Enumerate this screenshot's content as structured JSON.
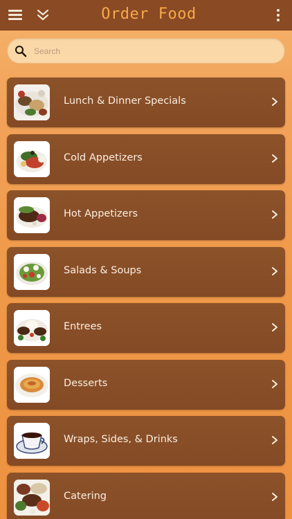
{
  "header": {
    "title": "Order Food",
    "menu_icon": "hamburger-menu-icon",
    "collapse_icon": "double-chevron-down-icon",
    "more_icon": "vertical-dots-icon"
  },
  "search": {
    "placeholder": "Search",
    "value": "",
    "icon": "search-icon"
  },
  "categories": [
    {
      "label": "Lunch & Dinner Specials",
      "thumb": "platter"
    },
    {
      "label": "Cold Appetizers",
      "thumb": "plate-salad"
    },
    {
      "label": "Hot Appetizers",
      "thumb": "meat-plate"
    },
    {
      "label": "Salads & Soups",
      "thumb": "salad"
    },
    {
      "label": "Entrees",
      "thumb": "kebab-rice"
    },
    {
      "label": "Desserts",
      "thumb": "dessert"
    },
    {
      "label": "Wraps, Sides, & Drinks",
      "thumb": "tea-cup"
    },
    {
      "label": "Catering",
      "thumb": "catering-spread"
    }
  ],
  "colors": {
    "header_bg": "#8a4a23",
    "title": "#f6a94a",
    "row_bg": "#8c5229",
    "row_text": "#fbeee0",
    "background": "#f2a35a"
  }
}
